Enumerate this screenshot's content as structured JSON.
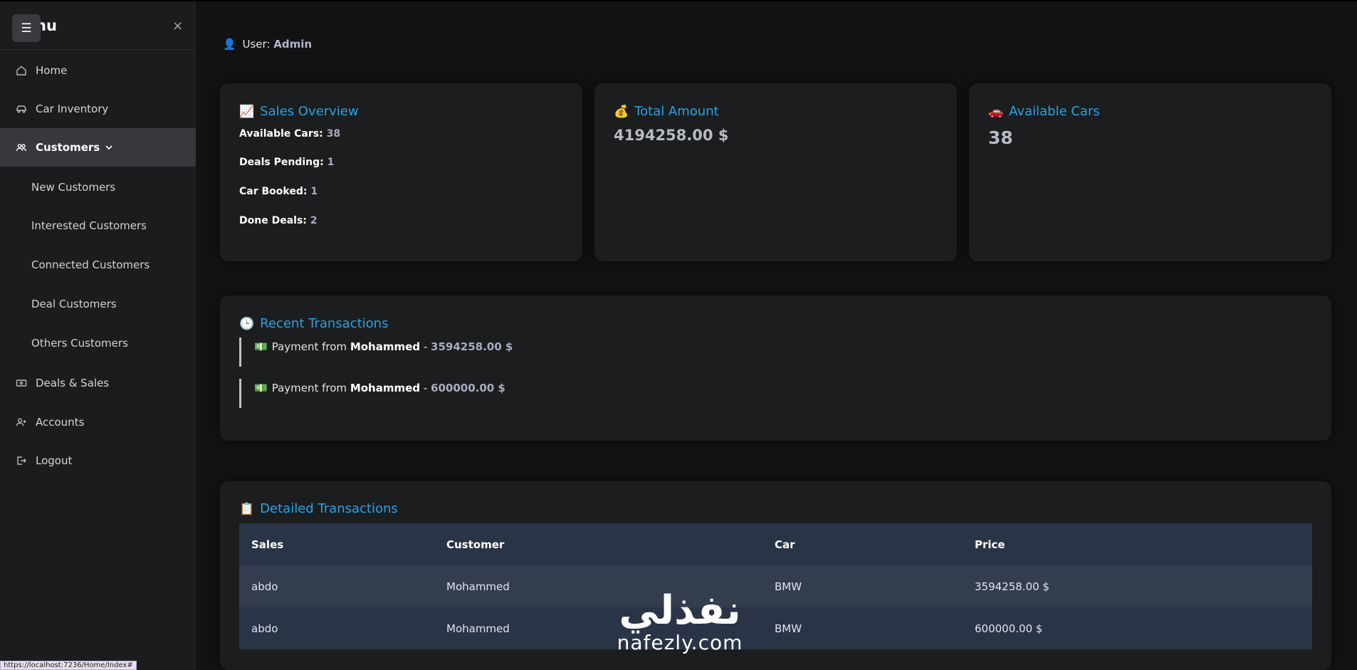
{
  "sidebar": {
    "title": "nu",
    "menu_icon": "☰",
    "close_icon": "×",
    "items": [
      {
        "label": "Home",
        "icon": "home-icon"
      },
      {
        "label": "Car Inventory",
        "icon": "car-icon"
      },
      {
        "label": "Customers",
        "icon": "users-icon"
      },
      {
        "label": "Deals & Sales",
        "icon": "cash-icon"
      },
      {
        "label": "Accounts",
        "icon": "user-plus-icon"
      },
      {
        "label": "Logout",
        "icon": "logout-icon"
      }
    ],
    "sub_items": [
      "New Customers",
      "Interested Customers",
      "Connected Customers",
      "Deal Customers",
      "Others Customers"
    ]
  },
  "user": {
    "prefix": "User:",
    "name": "Admin",
    "icon": "👤"
  },
  "sales_overview": {
    "title": "Sales Overview",
    "emoji": "📈",
    "stats": [
      {
        "label": "Available Cars:",
        "value": "38"
      },
      {
        "label": "Deals Pending:",
        "value": "1"
      },
      {
        "label": "Car Booked:",
        "value": "1"
      },
      {
        "label": "Done Deals:",
        "value": "2"
      }
    ]
  },
  "total_amount": {
    "title": "Total Amount",
    "emoji": "💰",
    "value": "4194258.00 $"
  },
  "available_cars": {
    "title": "Available Cars",
    "emoji": "🚗",
    "value": "38"
  },
  "recent_transactions": {
    "title": "Recent Transactions",
    "emoji": "🕒",
    "items": [
      {
        "emoji": "💵",
        "prefix": "Payment from",
        "name": "Mohammed",
        "sep": "-",
        "amount": "3594258.00 $"
      },
      {
        "emoji": "💵",
        "prefix": "Payment from",
        "name": "Mohammed",
        "sep": "-",
        "amount": "600000.00 $"
      }
    ]
  },
  "detailed_transactions": {
    "title": "Detailed Transactions",
    "emoji": "📋",
    "columns": [
      "Sales",
      "Customer",
      "Car",
      "Price"
    ],
    "rows": [
      [
        "abdo",
        "Mohammed",
        "BMW",
        "3594258.00 $"
      ],
      [
        "abdo",
        "Mohammed",
        "BMW",
        "600000.00 $"
      ]
    ]
  },
  "status_bar": {
    "url": "https://localhost:7236/Home/Index#"
  },
  "watermark": {
    "arabic": "نفذلي",
    "latin": "nafezly.com"
  },
  "colors": {
    "accent": "#29a3e3",
    "card_bg": "#1c1d1f",
    "sidebar_bg": "#1b1c1e",
    "table_header": "#2a3447"
  }
}
